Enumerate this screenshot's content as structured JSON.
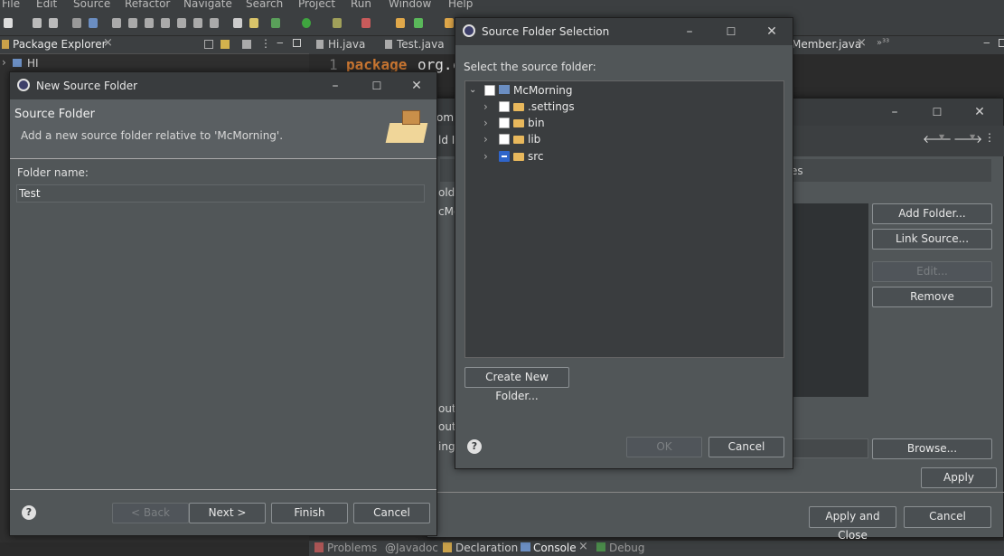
{
  "menubar": {
    "items": [
      "File",
      "Edit",
      "Source",
      "Refactor",
      "Navigate",
      "Search",
      "Project",
      "Run",
      "Window",
      "Help"
    ]
  },
  "package_explorer": {
    "title": "Package Explorer",
    "tree": [
      "HI"
    ]
  },
  "editor": {
    "tabs": [
      "Hi.java",
      "Test.java",
      "Member.java",
      "»³³"
    ],
    "line_number": "1",
    "keyword": "package",
    "code": "org.c"
  },
  "bottom_tabs": [
    "Problems",
    "Javadoc",
    "Declaration",
    "Console",
    "Debug"
  ],
  "properties_dialog": {
    "fragments": [
      "omi",
      "ld I",
      "olde",
      "cMo",
      "out",
      "outp",
      "ing/",
      "es"
    ],
    "buttons": {
      "add_folder": "Add Folder...",
      "link_source": "Link Source...",
      "edit": "Edit...",
      "remove": "Remove",
      "browse": "Browse...",
      "apply": "Apply",
      "apply_and_close": "Apply and Close",
      "cancel": "Cancel"
    }
  },
  "new_source_folder": {
    "title": "New Source Folder",
    "heading": "Source Folder",
    "description": "Add a new source folder relative to 'McMorning'.",
    "folder_name_label": "Folder name:",
    "folder_name_value": "Test",
    "buttons": {
      "back": "< Back",
      "next": "Next >",
      "finish": "Finish",
      "cancel": "Cancel"
    }
  },
  "source_folder_selection": {
    "title": "Source Folder Selection",
    "prompt": "Select the source folder:",
    "tree": [
      {
        "label": "McMorning",
        "expanded": true,
        "checked": "none"
      },
      {
        "label": ".settings",
        "expanded": false,
        "checked": "none"
      },
      {
        "label": "bin",
        "expanded": false,
        "checked": "none"
      },
      {
        "label": "lib",
        "expanded": false,
        "checked": "none"
      },
      {
        "label": "src",
        "expanded": false,
        "checked": "partial"
      }
    ],
    "buttons": {
      "create_new_folder": "Create New Folder...",
      "ok": "OK",
      "cancel": "Cancel"
    }
  },
  "colors": {
    "accent": "#2f65ca",
    "keyword": "#cc7832",
    "dialog_bg": "#515658"
  }
}
